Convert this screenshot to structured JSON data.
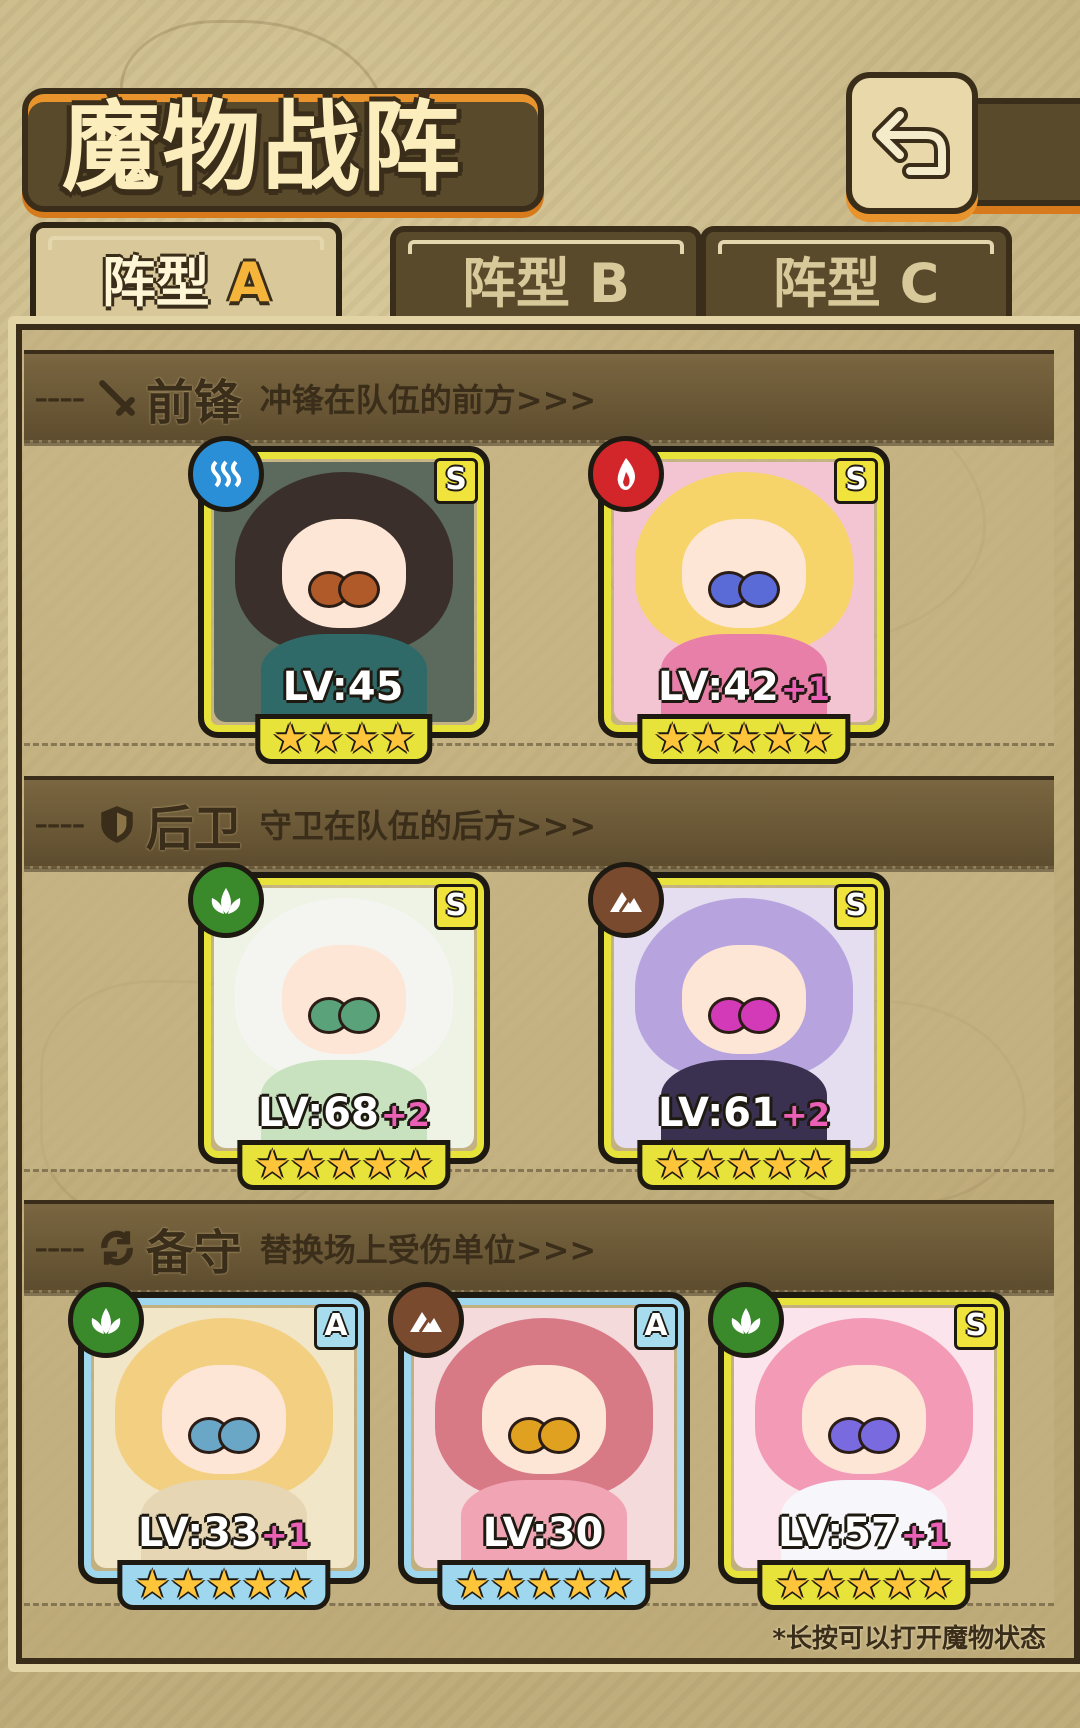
{
  "header": {
    "title": "魔物战阵",
    "back_icon": "back-arrow-icon"
  },
  "tabs": [
    {
      "label": "阵型",
      "suffix": "A",
      "active": true
    },
    {
      "label": "阵型",
      "suffix": "B",
      "active": false
    },
    {
      "label": "阵型",
      "suffix": "C",
      "active": false
    }
  ],
  "sections": {
    "front": {
      "title": "前锋",
      "desc": "冲锋在队伍的前方>>>",
      "icon": "sword-icon"
    },
    "rear": {
      "title": "后卫",
      "desc": "守卫在队伍的后方>>>",
      "icon": "shield-icon"
    },
    "reserve": {
      "title": "备守",
      "desc": "替换场上受伤单位>>>",
      "icon": "swap-icon"
    }
  },
  "units": {
    "front_1": {
      "level": "LV:45",
      "plus": "",
      "rank": "S",
      "stars": "★★★★",
      "element": "water",
      "element_color": "#2a8fd6"
    },
    "front_2": {
      "level": "LV:42",
      "plus": "+1",
      "rank": "S",
      "stars": "★★★★★",
      "element": "fire",
      "element_color": "#d3262b"
    },
    "rear_1": {
      "level": "LV:68",
      "plus": "+2",
      "rank": "S",
      "stars": "★★★★★",
      "element": "nature",
      "element_color": "#3a8a2c"
    },
    "rear_2": {
      "level": "LV:61",
      "plus": "+2",
      "rank": "S",
      "stars": "★★★★★",
      "element": "earth",
      "element_color": "#7a4a2e"
    },
    "reserve_1": {
      "level": "LV:33",
      "plus": "+1",
      "rank": "A",
      "stars": "★★★★★",
      "element": "nature",
      "element_color": "#3a8a2c"
    },
    "reserve_2": {
      "level": "LV:30",
      "plus": "",
      "rank": "A",
      "stars": "★★★★★",
      "element": "earth",
      "element_color": "#7a4a2e"
    },
    "reserve_3": {
      "level": "LV:57",
      "plus": "+1",
      "rank": "S",
      "stars": "★★★★★",
      "element": "nature",
      "element_color": "#3a8a2c"
    }
  },
  "footer": {
    "note": "*长按可以打开魔物状态"
  },
  "colors": {
    "accent_orange": "#e8932b",
    "frame_dark": "#3a2e1a",
    "rank_s": "#e7e33a",
    "rank_a": "#9fd7ee"
  }
}
